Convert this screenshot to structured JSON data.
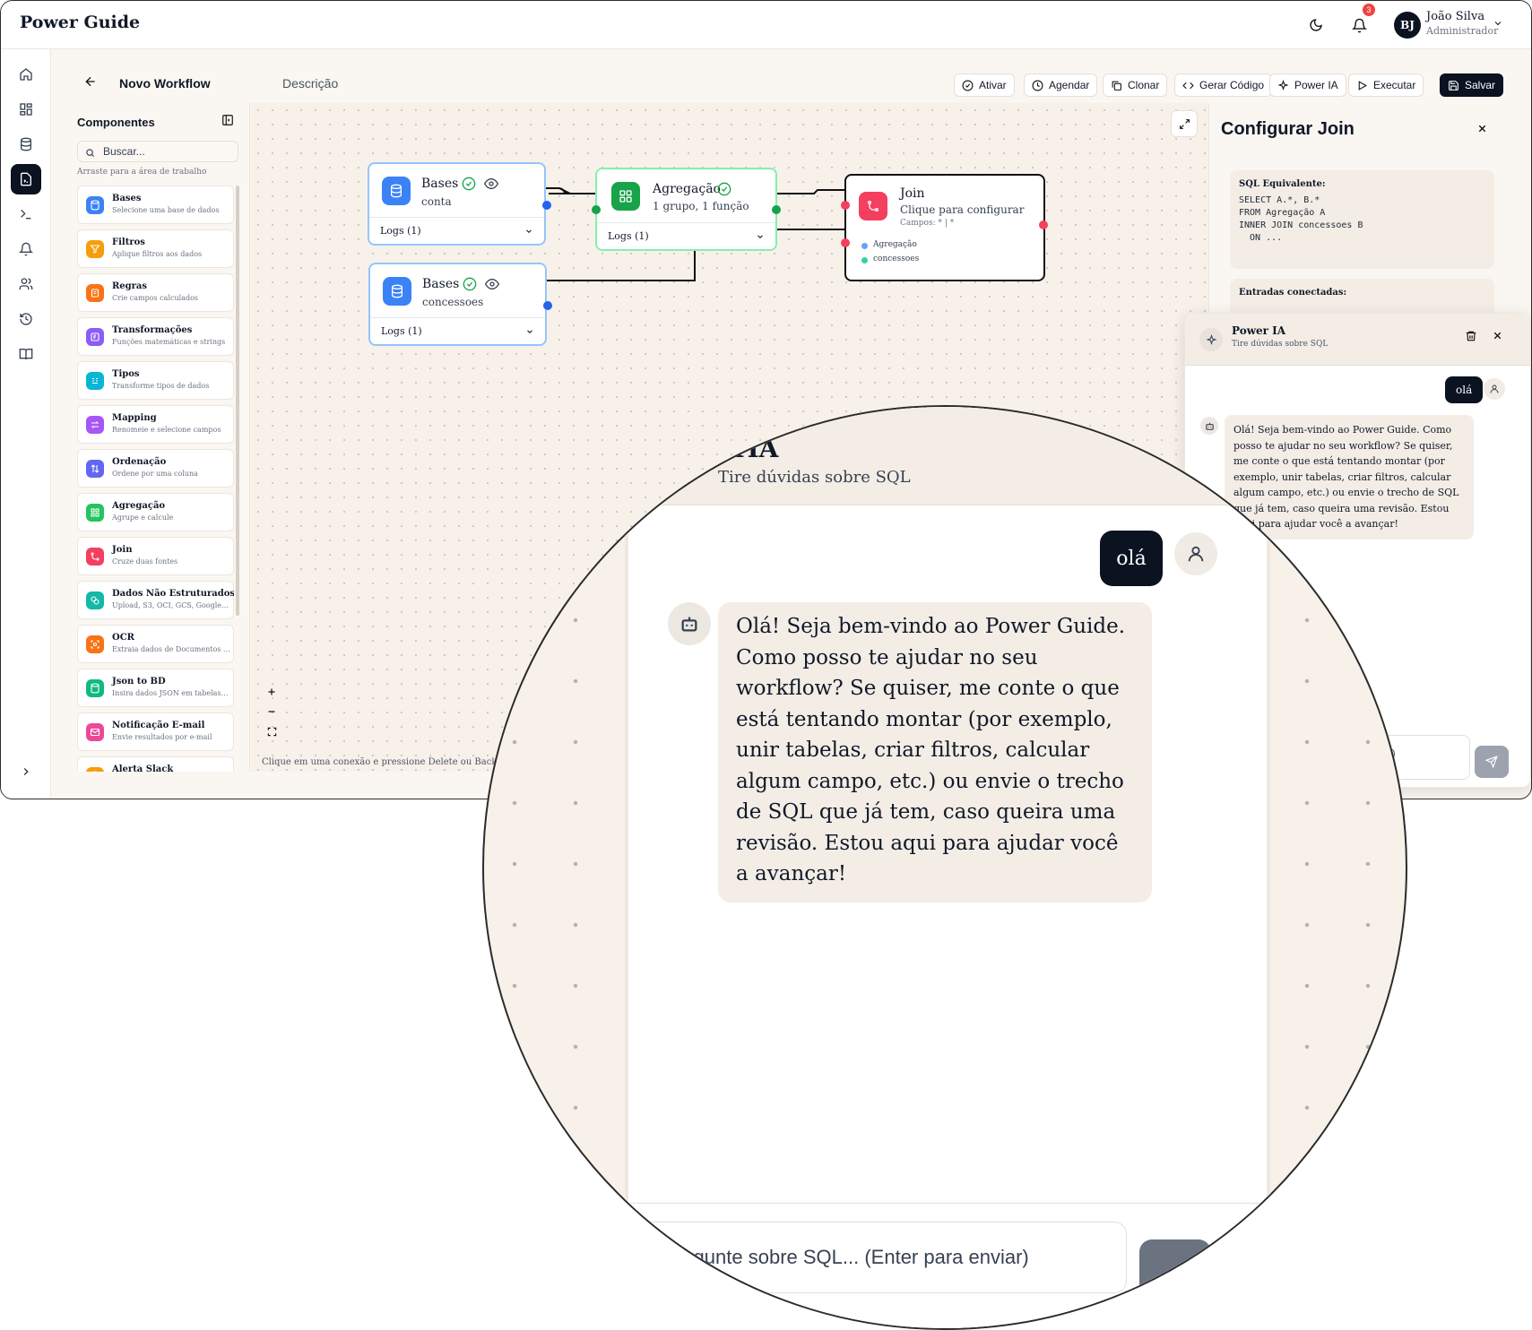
{
  "app": {
    "brand": "Power Guide",
    "notification_count": "3",
    "user": {
      "initials": "BJ",
      "name": "João Silva",
      "role": "Administrador"
    }
  },
  "workflow": {
    "title": "Novo Workflow",
    "description_placeholder": "Descrição",
    "actions": [
      "Ativar",
      "Agendar",
      "Clonar",
      "Gerar Código",
      "Power IA",
      "Executar",
      "Salvar"
    ]
  },
  "components": {
    "title": "Componentes",
    "search_placeholder": "Buscar...",
    "hint": "Arraste para a área de trabalho",
    "items": [
      {
        "name": "Bases",
        "desc": "Selecione uma base de dados",
        "color": "#3b82f6",
        "icon": "database-icon"
      },
      {
        "name": "Filtros",
        "desc": "Aplique filtros aos dados",
        "color": "#f59e0b",
        "icon": "filter-icon"
      },
      {
        "name": "Regras",
        "desc": "Crie campos calculados",
        "color": "#f97316",
        "icon": "rules-icon"
      },
      {
        "name": "Transformações",
        "desc": "Funções matemáticas e strings",
        "color": "#8b5cf6",
        "icon": "function-icon"
      },
      {
        "name": "Tipos",
        "desc": "Transforme tipos de dados",
        "color": "#06b6d4",
        "icon": "type-icon"
      },
      {
        "name": "Mapping",
        "desc": "Renomeie e selecione campos",
        "color": "#a855f7",
        "icon": "mapping-icon"
      },
      {
        "name": "Ordenação",
        "desc": "Ordene por uma coluna",
        "color": "#6366f1",
        "icon": "sort-icon"
      },
      {
        "name": "Agregação",
        "desc": "Agrupe e calcule",
        "color": "#22c55e",
        "icon": "aggregate-icon"
      },
      {
        "name": "Join",
        "desc": "Cruze duas fontes",
        "color": "#f43f5e",
        "icon": "join-icon"
      },
      {
        "name": "Dados Não Estruturados",
        "desc": "Upload, S3, OCI, GCS, Google ...",
        "color": "#14b8a6",
        "icon": "unstructured-icon"
      },
      {
        "name": "OCR",
        "desc": "Extraia dados de Documentos (F...",
        "color": "#f97316",
        "icon": "ocr-icon"
      },
      {
        "name": "Json to BD",
        "desc": "Insira dados JSON em tabelas do...",
        "color": "#10b981",
        "icon": "json-icon"
      },
      {
        "name": "Notificação E-mail",
        "desc": "Envie resultados por e-mail",
        "color": "#ec4899",
        "icon": "mail-icon"
      },
      {
        "name": "Alerta Slack",
        "desc": "",
        "color": "#f59e0b",
        "icon": "slack-icon"
      }
    ]
  },
  "canvas": {
    "hint": "Clique em uma conexão e pressione Delete ou Backspace",
    "nodes": {
      "bases_conta": {
        "title": "Bases",
        "sub": "conta",
        "logs": "Logs (1)"
      },
      "bases_concessoes": {
        "title": "Bases",
        "sub": "concessoes",
        "logs": "Logs (1)"
      },
      "agregacao": {
        "title": "Agregação",
        "sub": "1 grupo, 1 função",
        "logs": "Logs (1)"
      },
      "join": {
        "title": "Join",
        "sub": "Clique para configurar",
        "fields": "Campos: * | *",
        "input_a": "Agregação",
        "input_b": "concessoes"
      }
    }
  },
  "config": {
    "title": "Configurar Join",
    "sql_label": "SQL Equivalente:",
    "sql_code": "SELECT A.*, B.*\nFROM Agregação A\nINNER JOIN concessoes B\n  ON ...",
    "connected_label": "Entradas conectadas:"
  },
  "chat": {
    "title": "Power IA",
    "subtitle": "Tire dúvidas sobre SQL",
    "user_message": "olá",
    "bot_message": "Olá! Seja bem-vindo ao Power Guide. Como posso te ajudar no seu workflow? Se quiser, me conte o que está tentando montar (por exemplo, unir tabelas, criar filtros, calcular algum campo, etc.) ou envie o trecho de SQL que já tem, caso queira uma revisão. Estou aqui para ajudar você a avançar!",
    "input_placeholder": "Pergunte sobre SQL... (Enter para enviar)",
    "input_visible_fragment": "nviar)"
  },
  "magnifier": {
    "title_fragment": "erIA",
    "subtitle_fragment": "Tire dúvidas sobre SQL",
    "input_fragment": "ergunte sobre SQL... (Enter para enviar)"
  }
}
